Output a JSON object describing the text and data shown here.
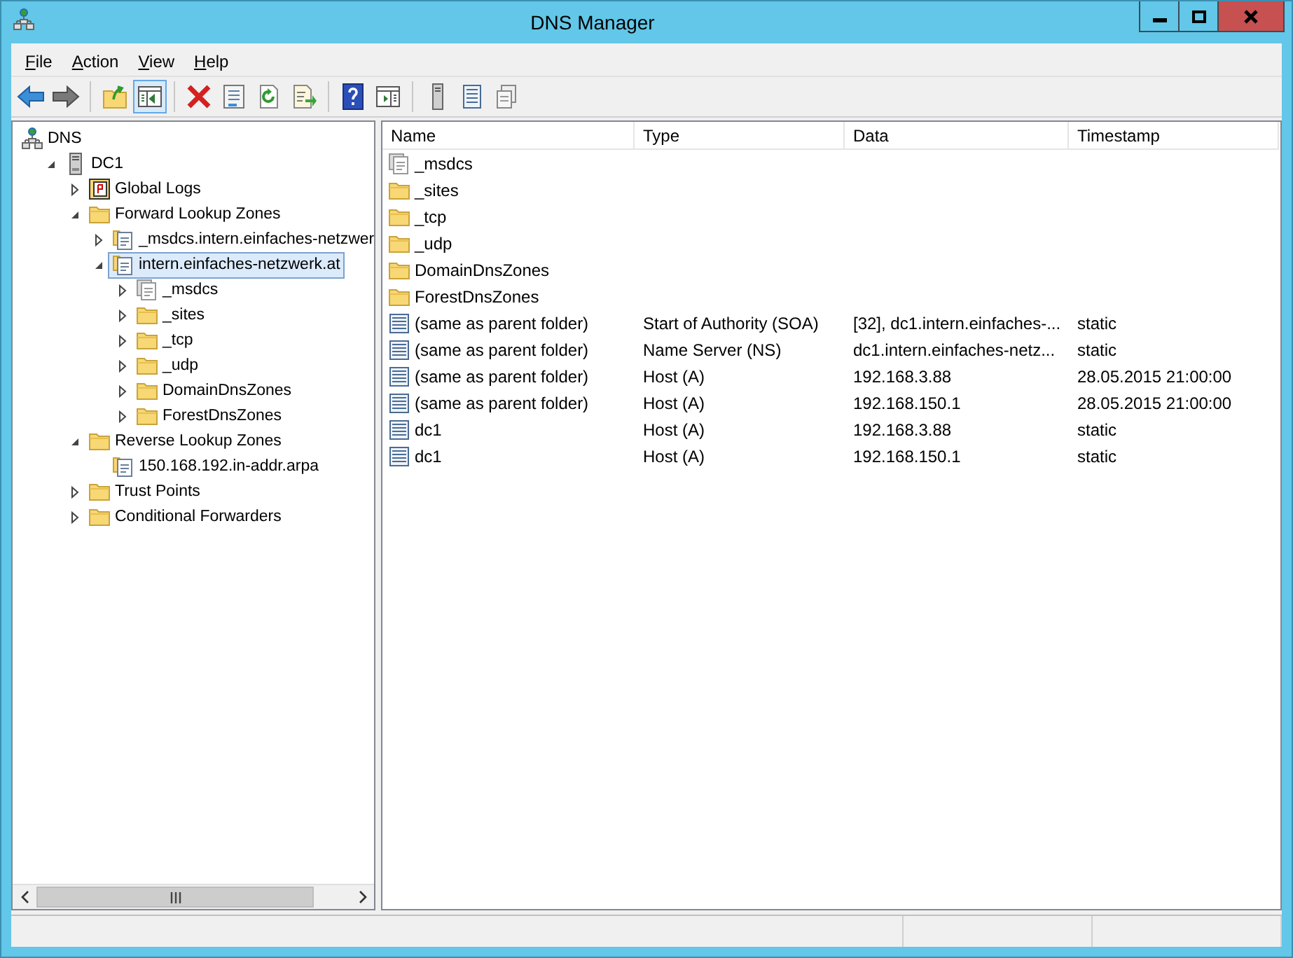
{
  "window": {
    "title": "DNS Manager"
  },
  "menu": [
    {
      "label": "File"
    },
    {
      "label": "Action"
    },
    {
      "label": "View"
    },
    {
      "label": "Help"
    }
  ],
  "toolbar": [
    {
      "kind": "back",
      "disabled": false,
      "pressed": false
    },
    {
      "kind": "forward",
      "disabled": true,
      "pressed": false
    },
    {
      "kind": "separator"
    },
    {
      "kind": "up",
      "disabled": false,
      "pressed": false
    },
    {
      "kind": "tree",
      "disabled": false,
      "pressed": true
    },
    {
      "kind": "separator"
    },
    {
      "kind": "delete",
      "disabled": false,
      "pressed": false
    },
    {
      "kind": "properties",
      "disabled": false,
      "pressed": false
    },
    {
      "kind": "refresh",
      "disabled": false,
      "pressed": false
    },
    {
      "kind": "export",
      "disabled": false,
      "pressed": false
    },
    {
      "kind": "separator"
    },
    {
      "kind": "help",
      "disabled": false,
      "pressed": false
    },
    {
      "kind": "pane",
      "disabled": false,
      "pressed": false
    },
    {
      "kind": "separator"
    },
    {
      "kind": "server",
      "disabled": false,
      "pressed": false
    },
    {
      "kind": "record",
      "disabled": false,
      "pressed": false
    },
    {
      "kind": "copy",
      "disabled": false,
      "pressed": false
    }
  ],
  "tree": [
    {
      "label": "DNS",
      "kind": "dns",
      "selected": false,
      "children": [
        {
          "label": "DC1",
          "kind": "server",
          "expanded": true,
          "selected": false,
          "children": [
            {
              "label": "Global Logs",
              "kind": "log",
              "expanded": false,
              "selected": false
            },
            {
              "label": "Forward Lookup Zones",
              "kind": "folder",
              "expanded": true,
              "selected": false,
              "children": [
                {
                  "label": "_msdcs.intern.einfaches-netzwer",
                  "kind": "zone",
                  "expanded": false,
                  "selected": false
                },
                {
                  "label": "intern.einfaches-netzwerk.at",
                  "kind": "zone",
                  "expanded": true,
                  "selected": true,
                  "children": [
                    {
                      "label": "_msdcs",
                      "kind": "delegation",
                      "expanded": false,
                      "selected": false
                    },
                    {
                      "label": "_sites",
                      "kind": "folder",
                      "expanded": false,
                      "selected": false
                    },
                    {
                      "label": "_tcp",
                      "kind": "folder",
                      "expanded": false,
                      "selected": false
                    },
                    {
                      "label": "_udp",
                      "kind": "folder",
                      "expanded": false,
                      "selected": false
                    },
                    {
                      "label": "DomainDnsZones",
                      "kind": "folder",
                      "expanded": false,
                      "selected": false
                    },
                    {
                      "label": "ForestDnsZones",
                      "kind": "folder",
                      "expanded": false,
                      "selected": false
                    }
                  ]
                }
              ]
            },
            {
              "label": "Reverse Lookup Zones",
              "kind": "folder",
              "expanded": true,
              "selected": false,
              "children": [
                {
                  "label": "150.168.192.in-addr.arpa",
                  "kind": "zone",
                  "selected": false
                }
              ]
            },
            {
              "label": "Trust Points",
              "kind": "folder",
              "expanded": false,
              "selected": false
            },
            {
              "label": "Conditional Forwarders",
              "kind": "folder",
              "expanded": false,
              "selected": false
            }
          ]
        }
      ]
    }
  ],
  "table": {
    "columns": [
      "Name",
      "Type",
      "Data",
      "Timestamp"
    ],
    "rows": [
      {
        "kind": "delegation",
        "cells": [
          "_msdcs",
          "",
          "",
          ""
        ]
      },
      {
        "kind": "folder",
        "cells": [
          "_sites",
          "",
          "",
          ""
        ]
      },
      {
        "kind": "folder",
        "cells": [
          "_tcp",
          "",
          "",
          ""
        ]
      },
      {
        "kind": "folder",
        "cells": [
          "_udp",
          "",
          "",
          ""
        ]
      },
      {
        "kind": "folder",
        "cells": [
          "DomainDnsZones",
          "",
          "",
          ""
        ]
      },
      {
        "kind": "folder",
        "cells": [
          "ForestDnsZones",
          "",
          "",
          ""
        ]
      },
      {
        "kind": "record",
        "cells": [
          "(same as parent folder)",
          "Start of Authority (SOA)",
          "[32], dc1.intern.einfaches-...",
          "static"
        ]
      },
      {
        "kind": "record",
        "cells": [
          "(same as parent folder)",
          "Name Server (NS)",
          "dc1.intern.einfaches-netz...",
          "static"
        ]
      },
      {
        "kind": "record",
        "cells": [
          "(same as parent folder)",
          "Host (A)",
          "192.168.3.88",
          "28.05.2015 21:00:00"
        ]
      },
      {
        "kind": "record",
        "cells": [
          "(same as parent folder)",
          "Host (A)",
          "192.168.150.1",
          "28.05.2015 21:00:00"
        ]
      },
      {
        "kind": "record",
        "cells": [
          "dc1",
          "Host (A)",
          "192.168.3.88",
          "static"
        ]
      },
      {
        "kind": "record",
        "cells": [
          "dc1",
          "Host (A)",
          "192.168.150.1",
          "static"
        ]
      }
    ]
  }
}
